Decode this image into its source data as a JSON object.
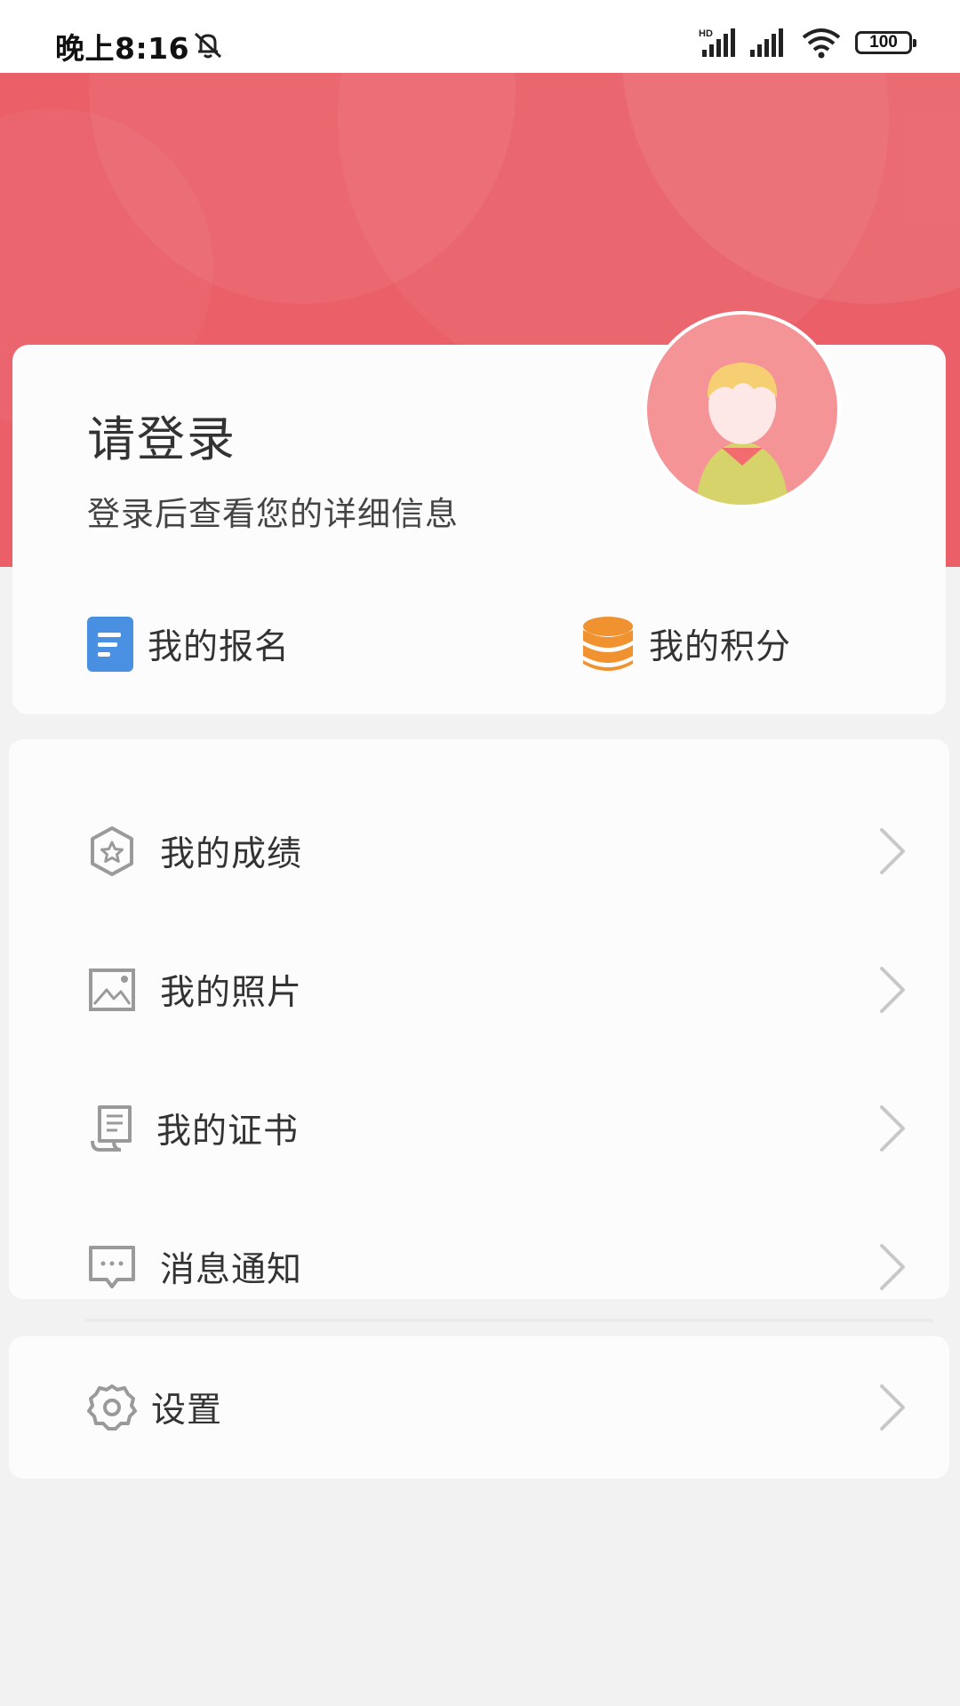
{
  "status_bar": {
    "time": "晚上8:16",
    "battery": "100",
    "network_label": "HD",
    "icons": [
      "mute-icon",
      "hd-signal-icon",
      "signal-icon",
      "wifi-icon",
      "battery-icon"
    ]
  },
  "profile": {
    "title": "请登录",
    "subtitle": "登录后查看您的详细信息",
    "avatar_icon": "default-avatar-icon"
  },
  "quick_links": [
    {
      "label": "我的报名",
      "icon": "document-icon",
      "color": "#4a90e2"
    },
    {
      "label": "我的积分",
      "icon": "coins-icon",
      "color": "#f0922f"
    }
  ],
  "menu": [
    {
      "label": "我的成绩",
      "icon": "badge-star-icon"
    },
    {
      "label": "我的照片",
      "icon": "photo-icon"
    },
    {
      "label": "我的证书",
      "icon": "certificate-icon"
    },
    {
      "label": "消息通知",
      "icon": "message-icon"
    }
  ],
  "settings": {
    "label": "设置",
    "icon": "gear-icon"
  },
  "colors": {
    "header": "#ea5f68",
    "avatar_bg": "#f59496",
    "page_bg": "#f2f2f2",
    "card_bg": "#fcfcfc",
    "icon_gray": "#9a9a9a"
  }
}
